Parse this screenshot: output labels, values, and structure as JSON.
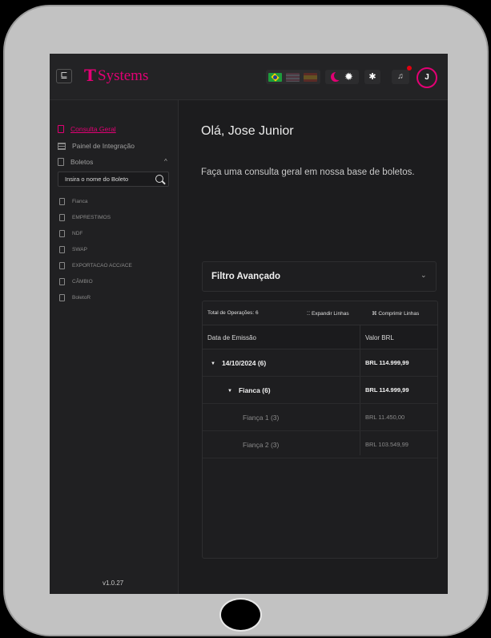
{
  "header": {
    "menu_toggle_icon": "collapse-menu-icon",
    "logo_mark": "T",
    "logo_text": "Systems",
    "brand_color": "#e20074",
    "languages": [
      "pt-BR",
      "en-US",
      "es-ES"
    ],
    "avatar_initial": "J"
  },
  "sidebar": {
    "items": [
      {
        "label": "Consulta Geral",
        "icon": "document-icon",
        "active": true
      },
      {
        "label": "Painel de Integração",
        "icon": "panel-icon",
        "active": false
      },
      {
        "label": "Boletos",
        "icon": "document-icon",
        "active": false
      }
    ],
    "search_placeholder": "Insira o nome do Boleto",
    "boletos": [
      "Fianca",
      "EMPRESTIMOS",
      "NDF",
      "SWAP",
      "EXPORTACAO ACC/ACE",
      "CÂMBIO",
      "BoletoR"
    ],
    "version": "v1.0.27"
  },
  "main": {
    "greeting": "Olá, Jose Junior",
    "intro": "Faça uma consulta geral em nossa base de boletos.",
    "filter_title": "Filtro Avançado"
  },
  "table": {
    "total": "Total de Operações: 6",
    "expand_label": "Expandir Linhas",
    "collapse_label": "Comprimir Linhas",
    "columns": [
      "Data de Emissão",
      "Valor BRL"
    ],
    "rows": [
      {
        "label": "14/10/2024 (6)",
        "value": "BRL 114.999,99",
        "level": 0
      },
      {
        "label": "Fianca (6)",
        "value": "BRL 114.999,99",
        "level": 1
      },
      {
        "label": "Fiança 1 (3)",
        "value": "BRL 11.450,00",
        "level": 2
      },
      {
        "label": "Fiança 2 (3)",
        "value": "BRL 103.549,99",
        "level": 2
      }
    ]
  }
}
